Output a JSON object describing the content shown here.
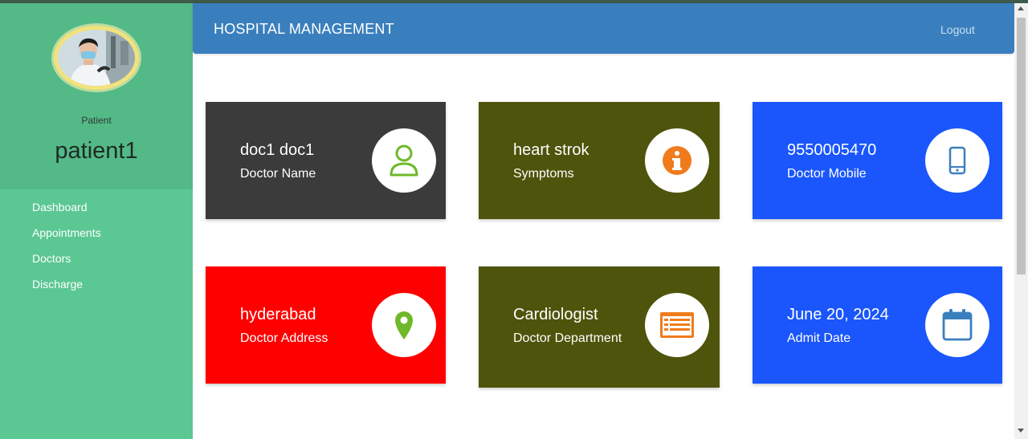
{
  "app": {
    "title": "HOSPITAL MANAGEMENT",
    "logout_label": "Logout"
  },
  "sidebar": {
    "role": "Patient",
    "username": "patient1",
    "items": [
      {
        "label": "Dashboard"
      },
      {
        "label": "Appointments"
      },
      {
        "label": "Doctors"
      },
      {
        "label": "Discharge"
      }
    ]
  },
  "cards": [
    {
      "value": "doc1 doc1",
      "label": "Doctor Name",
      "icon": "user-icon",
      "color": "#3b3b3b",
      "icon_color": "#6fb82a"
    },
    {
      "value": "heart strok",
      "label": "Symptoms",
      "icon": "info-icon",
      "color": "#4e540b",
      "icon_color": "#f07b1c"
    },
    {
      "value": "9550005470",
      "label": "Doctor Mobile",
      "icon": "mobile-icon",
      "color": "#1a56fb",
      "icon_color": "#3a7fbd"
    },
    {
      "value": "hyderabad",
      "label": "Doctor Address",
      "icon": "map-pin-icon",
      "color": "#fe0000",
      "icon_color": "#6fb82a"
    },
    {
      "value": "Cardiologist",
      "label": "Doctor Department",
      "icon": "list-card-icon",
      "color": "#4e540b",
      "icon_color": "#f07b1c"
    },
    {
      "value": "June 20, 2024",
      "label": "Admit Date",
      "icon": "calendar-icon",
      "color": "#1a56fb",
      "icon_color": "#3a7fbd"
    }
  ]
}
